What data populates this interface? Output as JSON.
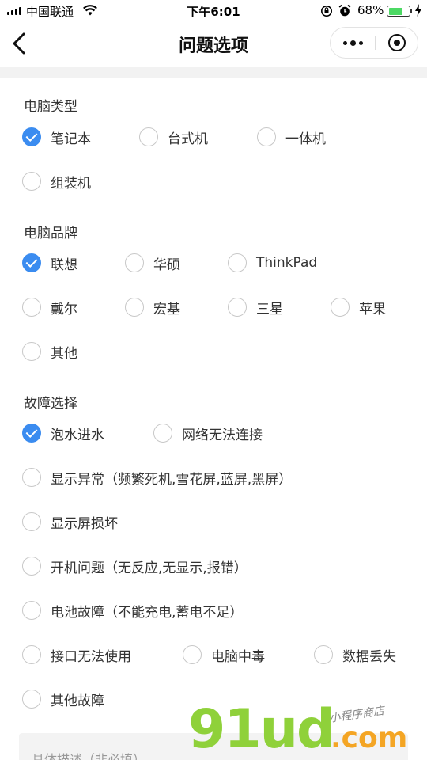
{
  "status_bar": {
    "carrier": "中国联通",
    "time": "下午6:01",
    "battery_percent": "68%",
    "battery_level": 0.68,
    "icons": [
      "signal-icon",
      "wifi-icon",
      "rotation-lock-icon",
      "alarm-icon",
      "battery-icon",
      "charging-icon"
    ]
  },
  "nav": {
    "title": "问题选项",
    "back_icon": "chevron-left-icon",
    "more_icon": "more-dots-icon",
    "close_icon": "target-circle-icon"
  },
  "colors": {
    "accent": "#3b8cf0",
    "radio_border": "#c8c8c8",
    "band": "#f2f2f2"
  },
  "sections": {
    "computer_type": {
      "title": "电脑类型",
      "options": [
        {
          "label": "笔记本",
          "checked": true
        },
        {
          "label": "台式机",
          "checked": false
        },
        {
          "label": "一体机",
          "checked": false
        },
        {
          "label": "组装机",
          "checked": false
        }
      ]
    },
    "brand": {
      "title": "电脑品牌",
      "options": [
        {
          "label": "联想",
          "checked": true
        },
        {
          "label": "华硕",
          "checked": false
        },
        {
          "label": "ThinkPad",
          "checked": false
        },
        {
          "label": "戴尔",
          "checked": false
        },
        {
          "label": "宏基",
          "checked": false
        },
        {
          "label": "三星",
          "checked": false
        },
        {
          "label": "苹果",
          "checked": false
        },
        {
          "label": "其他",
          "checked": false
        }
      ]
    },
    "fault": {
      "title": "故障选择",
      "options": [
        {
          "label": "泡水进水",
          "checked": true
        },
        {
          "label": "网络无法连接",
          "checked": false
        },
        {
          "label": "显示异常（频繁死机,雪花屏,蓝屏,黑屏）",
          "checked": false
        },
        {
          "label": "显示屏损坏",
          "checked": false
        },
        {
          "label": "开机问题（无反应,无显示,报错）",
          "checked": false
        },
        {
          "label": "电池故障（不能充电,蓄电不足）",
          "checked": false
        },
        {
          "label": "接口无法使用",
          "checked": false
        },
        {
          "label": "电脑中毒",
          "checked": false
        },
        {
          "label": "数据丢失",
          "checked": false
        },
        {
          "label": "其他故障",
          "checked": false
        }
      ]
    }
  },
  "description": {
    "placeholder": "具体描述（非必填）"
  },
  "watermark": {
    "logo_text": "91ud",
    "domain": ".com",
    "tagline": "小程序商店"
  }
}
